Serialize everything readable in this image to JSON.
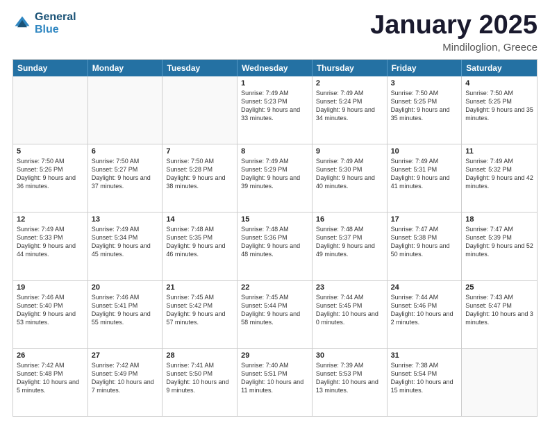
{
  "logo": {
    "line1": "General",
    "line2": "Blue"
  },
  "header": {
    "month": "January 2025",
    "location": "Mindiloglion, Greece"
  },
  "weekdays": [
    "Sunday",
    "Monday",
    "Tuesday",
    "Wednesday",
    "Thursday",
    "Friday",
    "Saturday"
  ],
  "rows": [
    [
      {
        "day": "",
        "text": ""
      },
      {
        "day": "",
        "text": ""
      },
      {
        "day": "",
        "text": ""
      },
      {
        "day": "1",
        "text": "Sunrise: 7:49 AM\nSunset: 5:23 PM\nDaylight: 9 hours and 33 minutes."
      },
      {
        "day": "2",
        "text": "Sunrise: 7:49 AM\nSunset: 5:24 PM\nDaylight: 9 hours and 34 minutes."
      },
      {
        "day": "3",
        "text": "Sunrise: 7:50 AM\nSunset: 5:25 PM\nDaylight: 9 hours and 35 minutes."
      },
      {
        "day": "4",
        "text": "Sunrise: 7:50 AM\nSunset: 5:25 PM\nDaylight: 9 hours and 35 minutes."
      }
    ],
    [
      {
        "day": "5",
        "text": "Sunrise: 7:50 AM\nSunset: 5:26 PM\nDaylight: 9 hours and 36 minutes."
      },
      {
        "day": "6",
        "text": "Sunrise: 7:50 AM\nSunset: 5:27 PM\nDaylight: 9 hours and 37 minutes."
      },
      {
        "day": "7",
        "text": "Sunrise: 7:50 AM\nSunset: 5:28 PM\nDaylight: 9 hours and 38 minutes."
      },
      {
        "day": "8",
        "text": "Sunrise: 7:49 AM\nSunset: 5:29 PM\nDaylight: 9 hours and 39 minutes."
      },
      {
        "day": "9",
        "text": "Sunrise: 7:49 AM\nSunset: 5:30 PM\nDaylight: 9 hours and 40 minutes."
      },
      {
        "day": "10",
        "text": "Sunrise: 7:49 AM\nSunset: 5:31 PM\nDaylight: 9 hours and 41 minutes."
      },
      {
        "day": "11",
        "text": "Sunrise: 7:49 AM\nSunset: 5:32 PM\nDaylight: 9 hours and 42 minutes."
      }
    ],
    [
      {
        "day": "12",
        "text": "Sunrise: 7:49 AM\nSunset: 5:33 PM\nDaylight: 9 hours and 44 minutes."
      },
      {
        "day": "13",
        "text": "Sunrise: 7:49 AM\nSunset: 5:34 PM\nDaylight: 9 hours and 45 minutes."
      },
      {
        "day": "14",
        "text": "Sunrise: 7:48 AM\nSunset: 5:35 PM\nDaylight: 9 hours and 46 minutes."
      },
      {
        "day": "15",
        "text": "Sunrise: 7:48 AM\nSunset: 5:36 PM\nDaylight: 9 hours and 48 minutes."
      },
      {
        "day": "16",
        "text": "Sunrise: 7:48 AM\nSunset: 5:37 PM\nDaylight: 9 hours and 49 minutes."
      },
      {
        "day": "17",
        "text": "Sunrise: 7:47 AM\nSunset: 5:38 PM\nDaylight: 9 hours and 50 minutes."
      },
      {
        "day": "18",
        "text": "Sunrise: 7:47 AM\nSunset: 5:39 PM\nDaylight: 9 hours and 52 minutes."
      }
    ],
    [
      {
        "day": "19",
        "text": "Sunrise: 7:46 AM\nSunset: 5:40 PM\nDaylight: 9 hours and 53 minutes."
      },
      {
        "day": "20",
        "text": "Sunrise: 7:46 AM\nSunset: 5:41 PM\nDaylight: 9 hours and 55 minutes."
      },
      {
        "day": "21",
        "text": "Sunrise: 7:45 AM\nSunset: 5:42 PM\nDaylight: 9 hours and 57 minutes."
      },
      {
        "day": "22",
        "text": "Sunrise: 7:45 AM\nSunset: 5:44 PM\nDaylight: 9 hours and 58 minutes."
      },
      {
        "day": "23",
        "text": "Sunrise: 7:44 AM\nSunset: 5:45 PM\nDaylight: 10 hours and 0 minutes."
      },
      {
        "day": "24",
        "text": "Sunrise: 7:44 AM\nSunset: 5:46 PM\nDaylight: 10 hours and 2 minutes."
      },
      {
        "day": "25",
        "text": "Sunrise: 7:43 AM\nSunset: 5:47 PM\nDaylight: 10 hours and 3 minutes."
      }
    ],
    [
      {
        "day": "26",
        "text": "Sunrise: 7:42 AM\nSunset: 5:48 PM\nDaylight: 10 hours and 5 minutes."
      },
      {
        "day": "27",
        "text": "Sunrise: 7:42 AM\nSunset: 5:49 PM\nDaylight: 10 hours and 7 minutes."
      },
      {
        "day": "28",
        "text": "Sunrise: 7:41 AM\nSunset: 5:50 PM\nDaylight: 10 hours and 9 minutes."
      },
      {
        "day": "29",
        "text": "Sunrise: 7:40 AM\nSunset: 5:51 PM\nDaylight: 10 hours and 11 minutes."
      },
      {
        "day": "30",
        "text": "Sunrise: 7:39 AM\nSunset: 5:53 PM\nDaylight: 10 hours and 13 minutes."
      },
      {
        "day": "31",
        "text": "Sunrise: 7:38 AM\nSunset: 5:54 PM\nDaylight: 10 hours and 15 minutes."
      },
      {
        "day": "",
        "text": ""
      }
    ]
  ]
}
